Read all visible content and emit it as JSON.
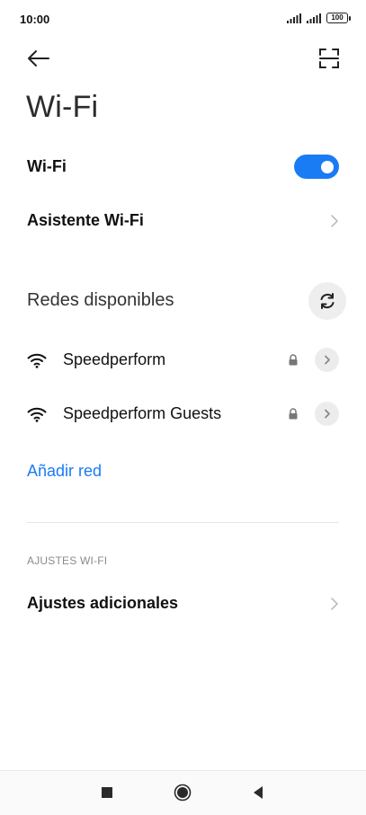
{
  "status_bar": {
    "time": "10:00",
    "battery": "100",
    "icons": [
      "signal-icon",
      "signal-icon",
      "battery-icon"
    ]
  },
  "toolbar": {
    "back_icon": "arrow-left-icon",
    "scan_icon": "qr-scan-icon"
  },
  "page": {
    "title": "Wi-Fi"
  },
  "wifi_toggle": {
    "label": "Wi-Fi",
    "state": "on",
    "accent": "#1a7cf5"
  },
  "assistant": {
    "label": "Asistente Wi-Fi"
  },
  "available": {
    "heading": "Redes disponibles",
    "refresh_icon": "refresh-icon",
    "networks": [
      {
        "name": "Speedperform",
        "secured": true
      },
      {
        "name": "Speedperform Guests",
        "secured": true
      }
    ],
    "add_label": "Añadir red"
  },
  "settings": {
    "subheading": "AJUSTES WI-FI",
    "additional_label": "Ajustes adicionales"
  },
  "navbar": {
    "icons": [
      "recents-icon",
      "home-icon",
      "back-icon"
    ]
  }
}
